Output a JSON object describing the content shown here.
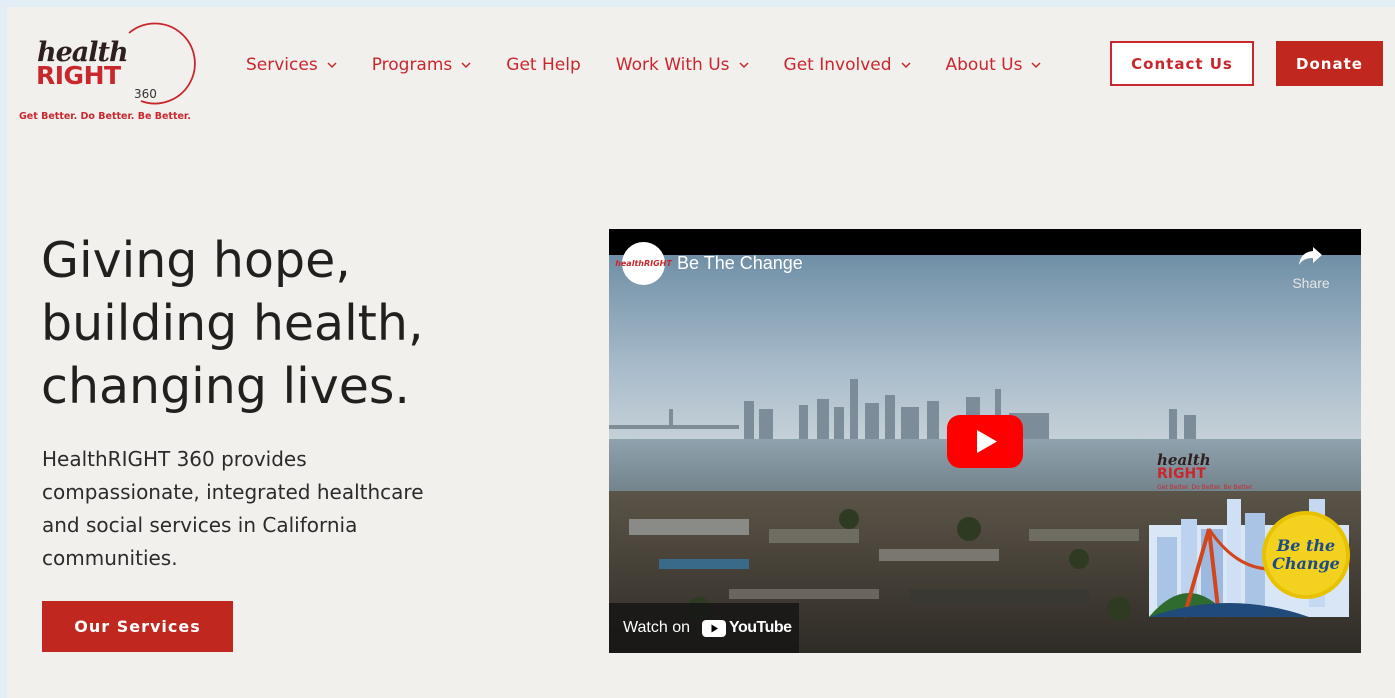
{
  "brand": {
    "logo_top": "health",
    "logo_main": "RIGHT",
    "logo_number": "360",
    "tagline": "Get Better. Do Better. Be Better."
  },
  "nav": {
    "items": [
      {
        "label": "Services",
        "has_dropdown": true
      },
      {
        "label": "Programs",
        "has_dropdown": true
      },
      {
        "label": "Get Help",
        "has_dropdown": false
      },
      {
        "label": "Work With Us",
        "has_dropdown": true
      },
      {
        "label": "Get Involved",
        "has_dropdown": true
      },
      {
        "label": "About Us",
        "has_dropdown": true
      }
    ],
    "contact_label": "Contact Us",
    "donate_label": "Donate"
  },
  "hero": {
    "title_lines": [
      "Giving hope,",
      "building health,",
      "changing lives."
    ],
    "description": "HealthRIGHT 360 provides compassionate, integrated healthcare and social services in California communities.",
    "cta_label": "Our Services"
  },
  "video": {
    "channel_avatar_text": "healthRIGHT",
    "title": "Be The Change",
    "share_label": "Share",
    "watch_on_label": "Watch on",
    "youtube_label": "YouTube",
    "overlay_brand_top": "health",
    "overlay_brand_main": "RIGHT",
    "overlay_brand_tag": "Get Better. Do Better. Be Better.",
    "badge_line1": "Be the",
    "badge_line2": "Change"
  },
  "colors": {
    "brand_red": "#c0271f",
    "background": "#f2f0ed",
    "text_dark": "#221f1f"
  }
}
